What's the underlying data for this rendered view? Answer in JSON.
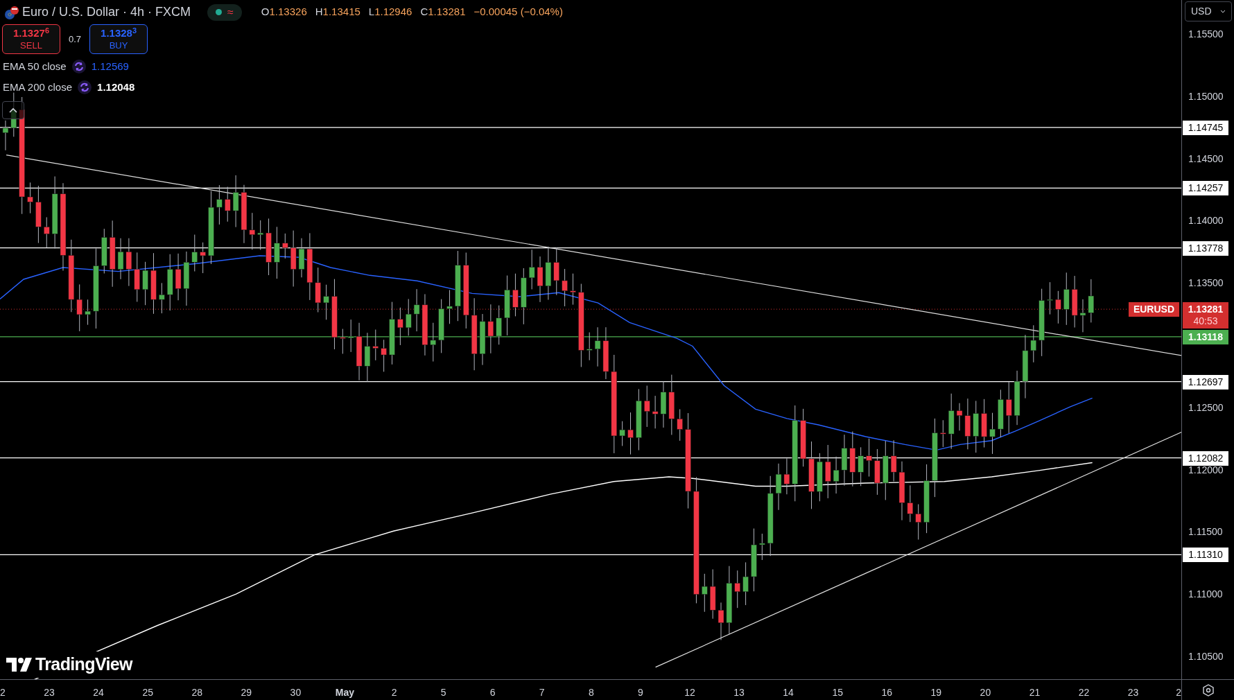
{
  "header": {
    "title": "Euro / U.S. Dollar · 4h · FXCM",
    "status_symbol": "≈",
    "ohlc": [
      {
        "key": "O",
        "value": "1.13326"
      },
      {
        "key": "H",
        "value": "1.13415"
      },
      {
        "key": "L",
        "value": "1.12946"
      },
      {
        "key": "C",
        "value": "1.13281"
      }
    ],
    "change": "−0.00045 (−0.04%)"
  },
  "trade": {
    "sell": {
      "price": "1.1327",
      "pip": "6",
      "label": "SELL"
    },
    "spread": "0.7",
    "buy": {
      "price": "1.1328",
      "pip": "3",
      "label": "BUY"
    }
  },
  "indicators": [
    {
      "name": "EMA 50 close",
      "value": "1.12569",
      "color": "#2962ff"
    },
    {
      "name": "EMA 200 close",
      "value": "1.12048",
      "color": "#ffffff"
    }
  ],
  "currency_select": "USD",
  "price_axis": [
    "1.15500",
    "1.15000",
    "1.14500",
    "1.14000",
    "1.13500",
    "1.12500",
    "1.12000",
    "1.11500",
    "1.11000",
    "1.10500"
  ],
  "level_tags": [
    {
      "text": "1.14745",
      "kind": "level"
    },
    {
      "text": "1.14257",
      "kind": "level"
    },
    {
      "text": "1.13778",
      "kind": "level"
    },
    {
      "text": "1.13118",
      "kind": "alert"
    },
    {
      "text": "1.12697",
      "kind": "level"
    },
    {
      "text": "1.12082",
      "kind": "level"
    },
    {
      "text": "1.11310",
      "kind": "level"
    }
  ],
  "price_tag": {
    "symbol": "EURUSD",
    "price": "1.13281",
    "countdown": "40:53"
  },
  "time_axis": [
    "2",
    "23",
    "24",
    "25",
    "28",
    "29",
    "30",
    "May",
    "2",
    "5",
    "6",
    "7",
    "8",
    "9",
    "12",
    "13",
    "14",
    "15",
    "16",
    "19",
    "20",
    "21",
    "22",
    "23",
    "2"
  ],
  "branding": "TradingView"
}
